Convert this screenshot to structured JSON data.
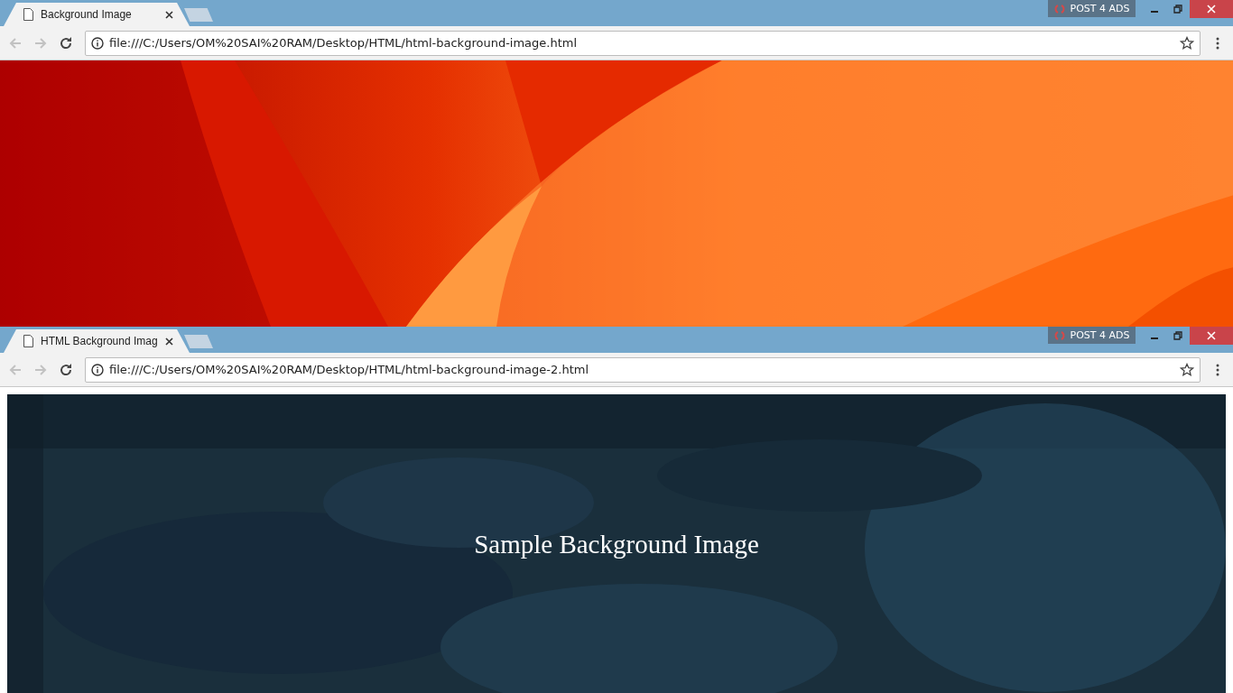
{
  "windows": [
    {
      "tab": {
        "title": "Background Image",
        "selected": true
      },
      "badge": "POST 4 ADS",
      "address": "file:///C:/Users/OM%20SAI%20RAM/Desktop/HTML/html-background-image.html",
      "page": {
        "kind": "flames"
      }
    },
    {
      "tab": {
        "title": "HTML Background Imag",
        "selected": true
      },
      "badge": "POST 4 ADS",
      "address": "file:///C:/Users/OM%20SAI%20RAM/Desktop/HTML/html-background-image-2.html",
      "page": {
        "kind": "texture",
        "heading": "Sample Background Image"
      }
    }
  ]
}
